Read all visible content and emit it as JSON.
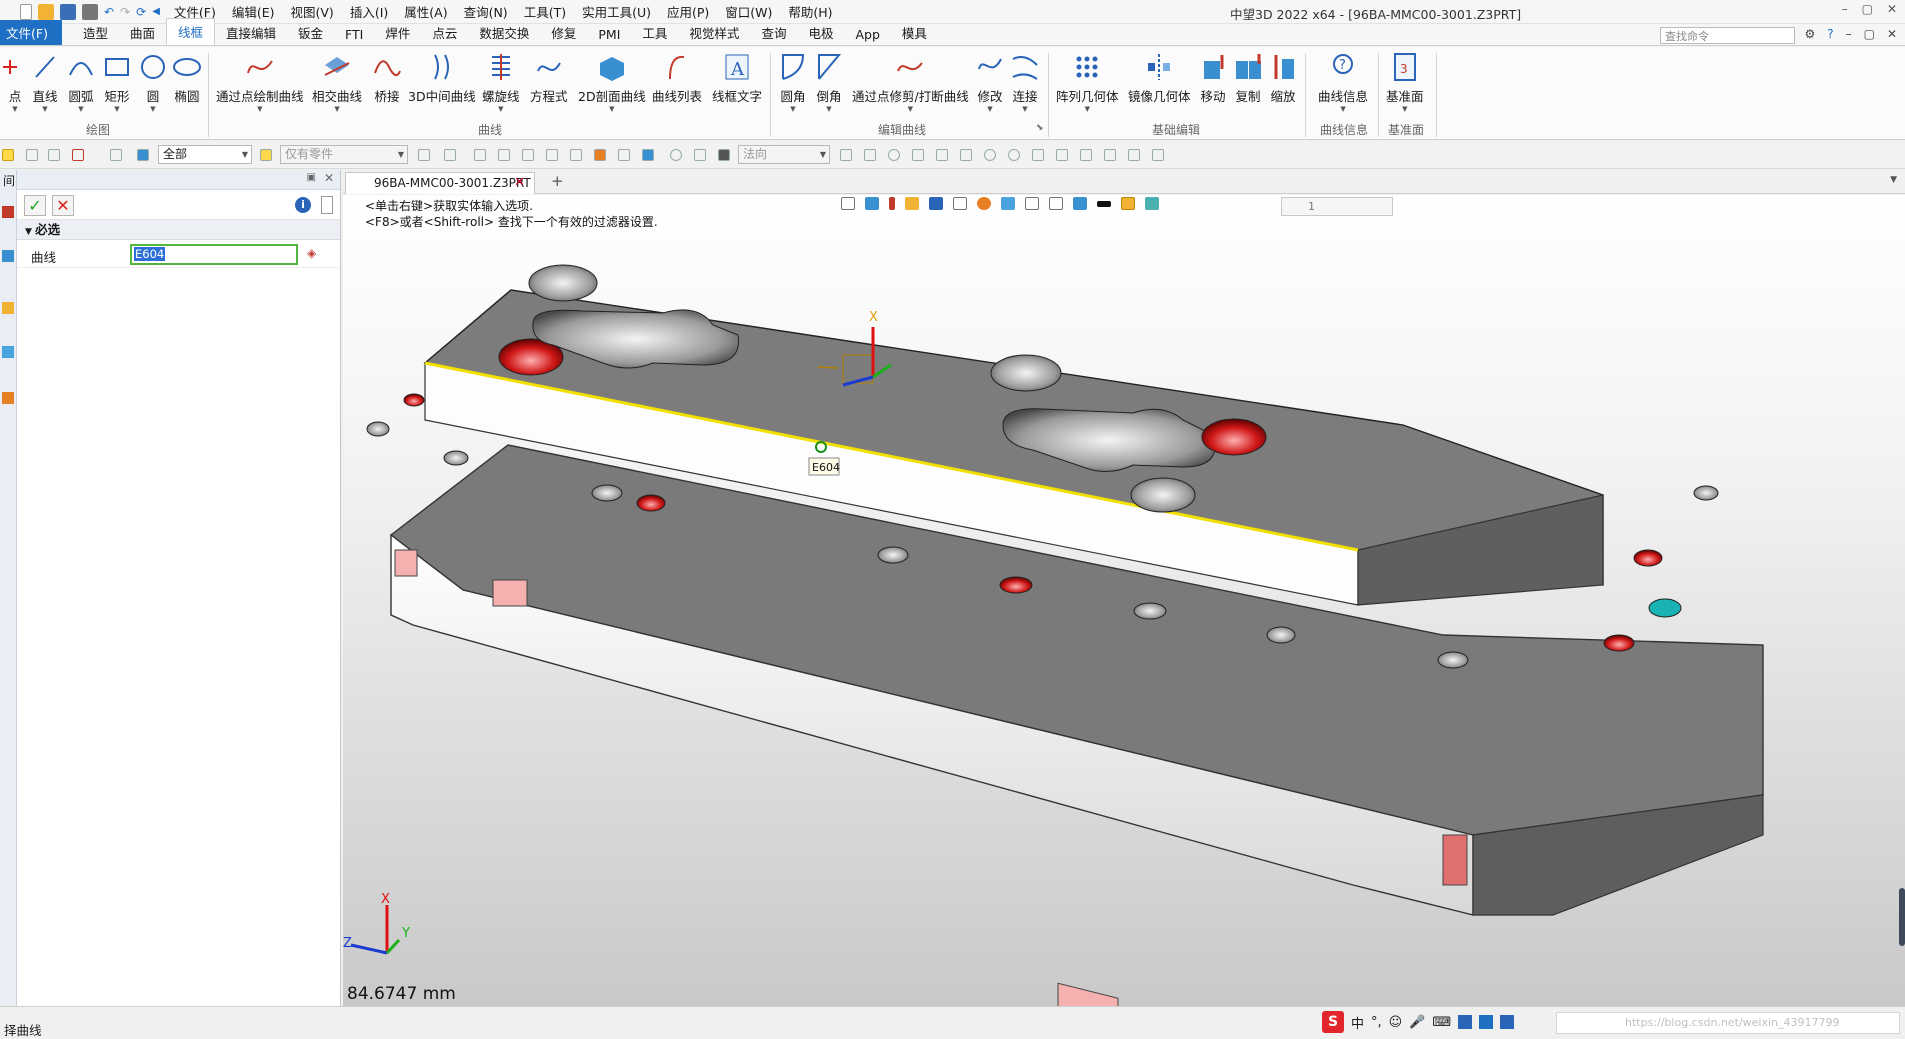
{
  "title_bar": {
    "menus": [
      "文件(F)",
      "编辑(E)",
      "视图(V)",
      "插入(I)",
      "属性(A)",
      "查询(N)",
      "工具(T)",
      "实用工具(U)",
      "应用(P)",
      "窗口(W)",
      "帮助(H)"
    ],
    "window_title": "中望3D 2022 x64 - [96BA-MMC00-3001.Z3PRT]",
    "window_controls": [
      "–",
      "▢",
      "✕"
    ]
  },
  "ribbon_tabs": {
    "file": "文件(F)",
    "tabs": [
      "造型",
      "曲面",
      "线框",
      "直接编辑",
      "钣金",
      "FTI",
      "焊件",
      "点云",
      "数据交换",
      "修复",
      "PMI",
      "工具",
      "视觉样式",
      "查询",
      "电极",
      "App",
      "模具"
    ],
    "active": "线框",
    "search_placeholder": "查找命令"
  },
  "ribbon": {
    "buttons": [
      "点",
      "直线",
      "圆弧",
      "矩形",
      "圆",
      "椭圆",
      "通过点绘制曲线",
      "相交曲线",
      "桥接",
      "3D中间曲线",
      "螺旋线",
      "方程式",
      "2D剖面曲线",
      "曲线列表",
      "线框文字",
      "圆角",
      "倒角",
      "通过点修剪/打断曲线",
      "修改",
      "连接",
      "阵列几何体",
      "镜像几何体",
      "移动",
      "复制",
      "缩放",
      "曲线信息",
      "基准面"
    ],
    "groups": [
      "绘图",
      "曲线",
      "编辑曲线",
      "基础编辑",
      "曲线信息",
      "基准面"
    ]
  },
  "toolbar2": {
    "filter_value": "全部",
    "parts_value": "仅有零件",
    "normal_value": "法向"
  },
  "left_panel": {
    "title": "间",
    "section": "必选",
    "field_label": "曲线",
    "field_value": "E604"
  },
  "viewport": {
    "doc_tab": "96BA-MMC00-3001.Z3PRT",
    "prompt_line1": "<单击右键>获取实体输入选项.",
    "prompt_line2": "<F8>或者<Shift-roll> 查找下一个有效的过滤器设置.",
    "layer_value": "1",
    "edge_label": "E604",
    "triad_labels": {
      "x": "X",
      "y": "Y",
      "z": "Z"
    },
    "measurement": "84.6747 mm"
  },
  "status_bar": {
    "text": "择曲线",
    "ime": [
      "中",
      "°,",
      "☺",
      "🎤",
      "⌨"
    ],
    "right_box": "https://blog.csdn.net/weixin_43917799"
  }
}
